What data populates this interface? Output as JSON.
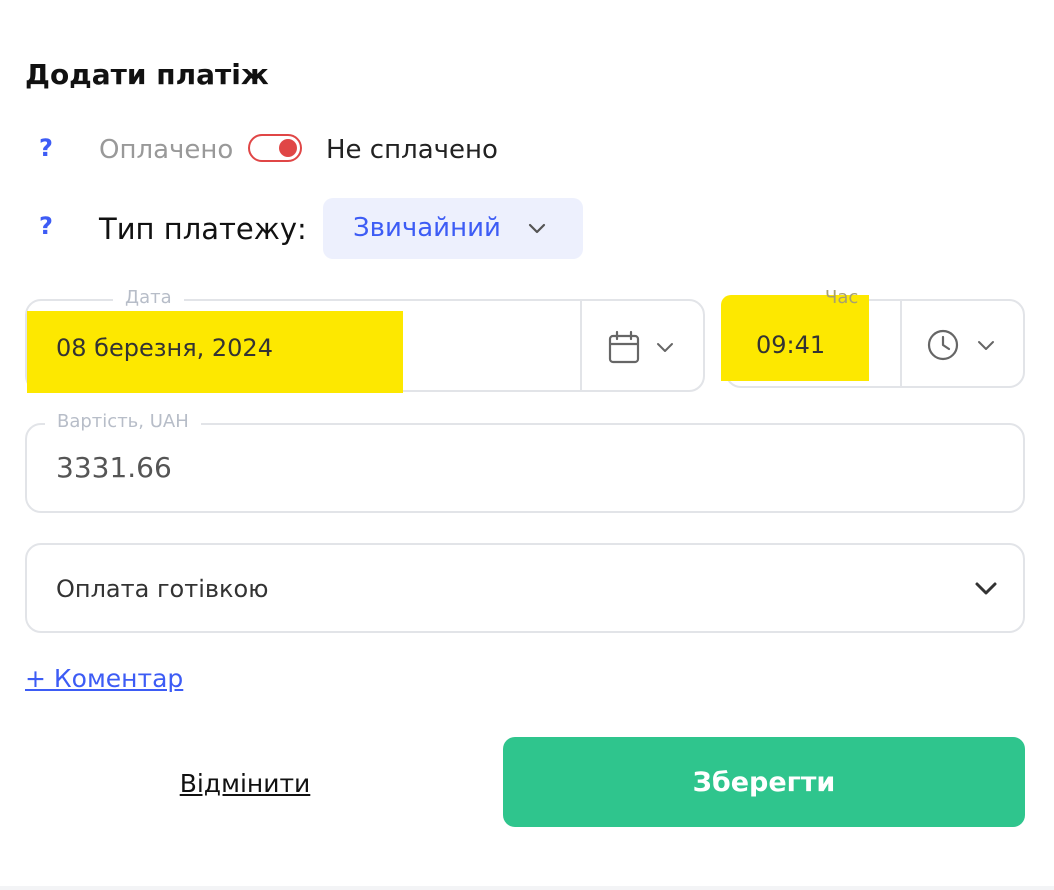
{
  "title": "Додати платіж",
  "help_symbol": "?",
  "status": {
    "paid_label": "Оплачено",
    "unpaid_label": "Не сплачено",
    "is_paid": false
  },
  "payment_type": {
    "label": "Тип платежу:",
    "value": "Звичайний"
  },
  "date": {
    "legend": "Дата",
    "value": "08 березня, 2024"
  },
  "time": {
    "legend": "Час",
    "value": "09:41"
  },
  "cost": {
    "legend": "Вартість, UAH",
    "value": "3331.66"
  },
  "payment_method": {
    "value": "Оплата готівкою"
  },
  "comment_link": "+ Коментар",
  "buttons": {
    "cancel": "Відмінити",
    "save": "Зберегти"
  },
  "colors": {
    "accent": "#3d5cf5",
    "toggle_off": "#e04646",
    "save": "#2fc58d",
    "highlight": "#fde800"
  },
  "icons": [
    "help-icon",
    "calendar-icon",
    "clock-icon",
    "chevron-down-icon"
  ]
}
